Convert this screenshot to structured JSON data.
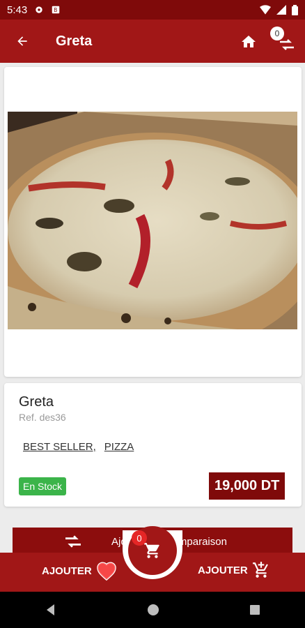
{
  "status_bar": {
    "time": "5:43"
  },
  "app_bar": {
    "title": "Greta",
    "compare_count": "0"
  },
  "product": {
    "name": "Greta",
    "reference": "Ref. des36",
    "categories": [
      "BEST SELLER,",
      "PIZZA"
    ],
    "stock_label": "En Stock",
    "price": "19,000 DT"
  },
  "actions": {
    "compare_label": "Ajouter à la comparaison",
    "add_favorite_label": "AJOUTER",
    "add_cart_label": "AJOUTER",
    "cart_count": "0"
  },
  "colors": {
    "primary": "#a11717",
    "dark": "#7f0a0a",
    "stock": "#3bb44a"
  },
  "icons": [
    "back-icon",
    "home-icon",
    "compare-icon",
    "heart-icon",
    "cart-add-icon",
    "cart-icon"
  ]
}
